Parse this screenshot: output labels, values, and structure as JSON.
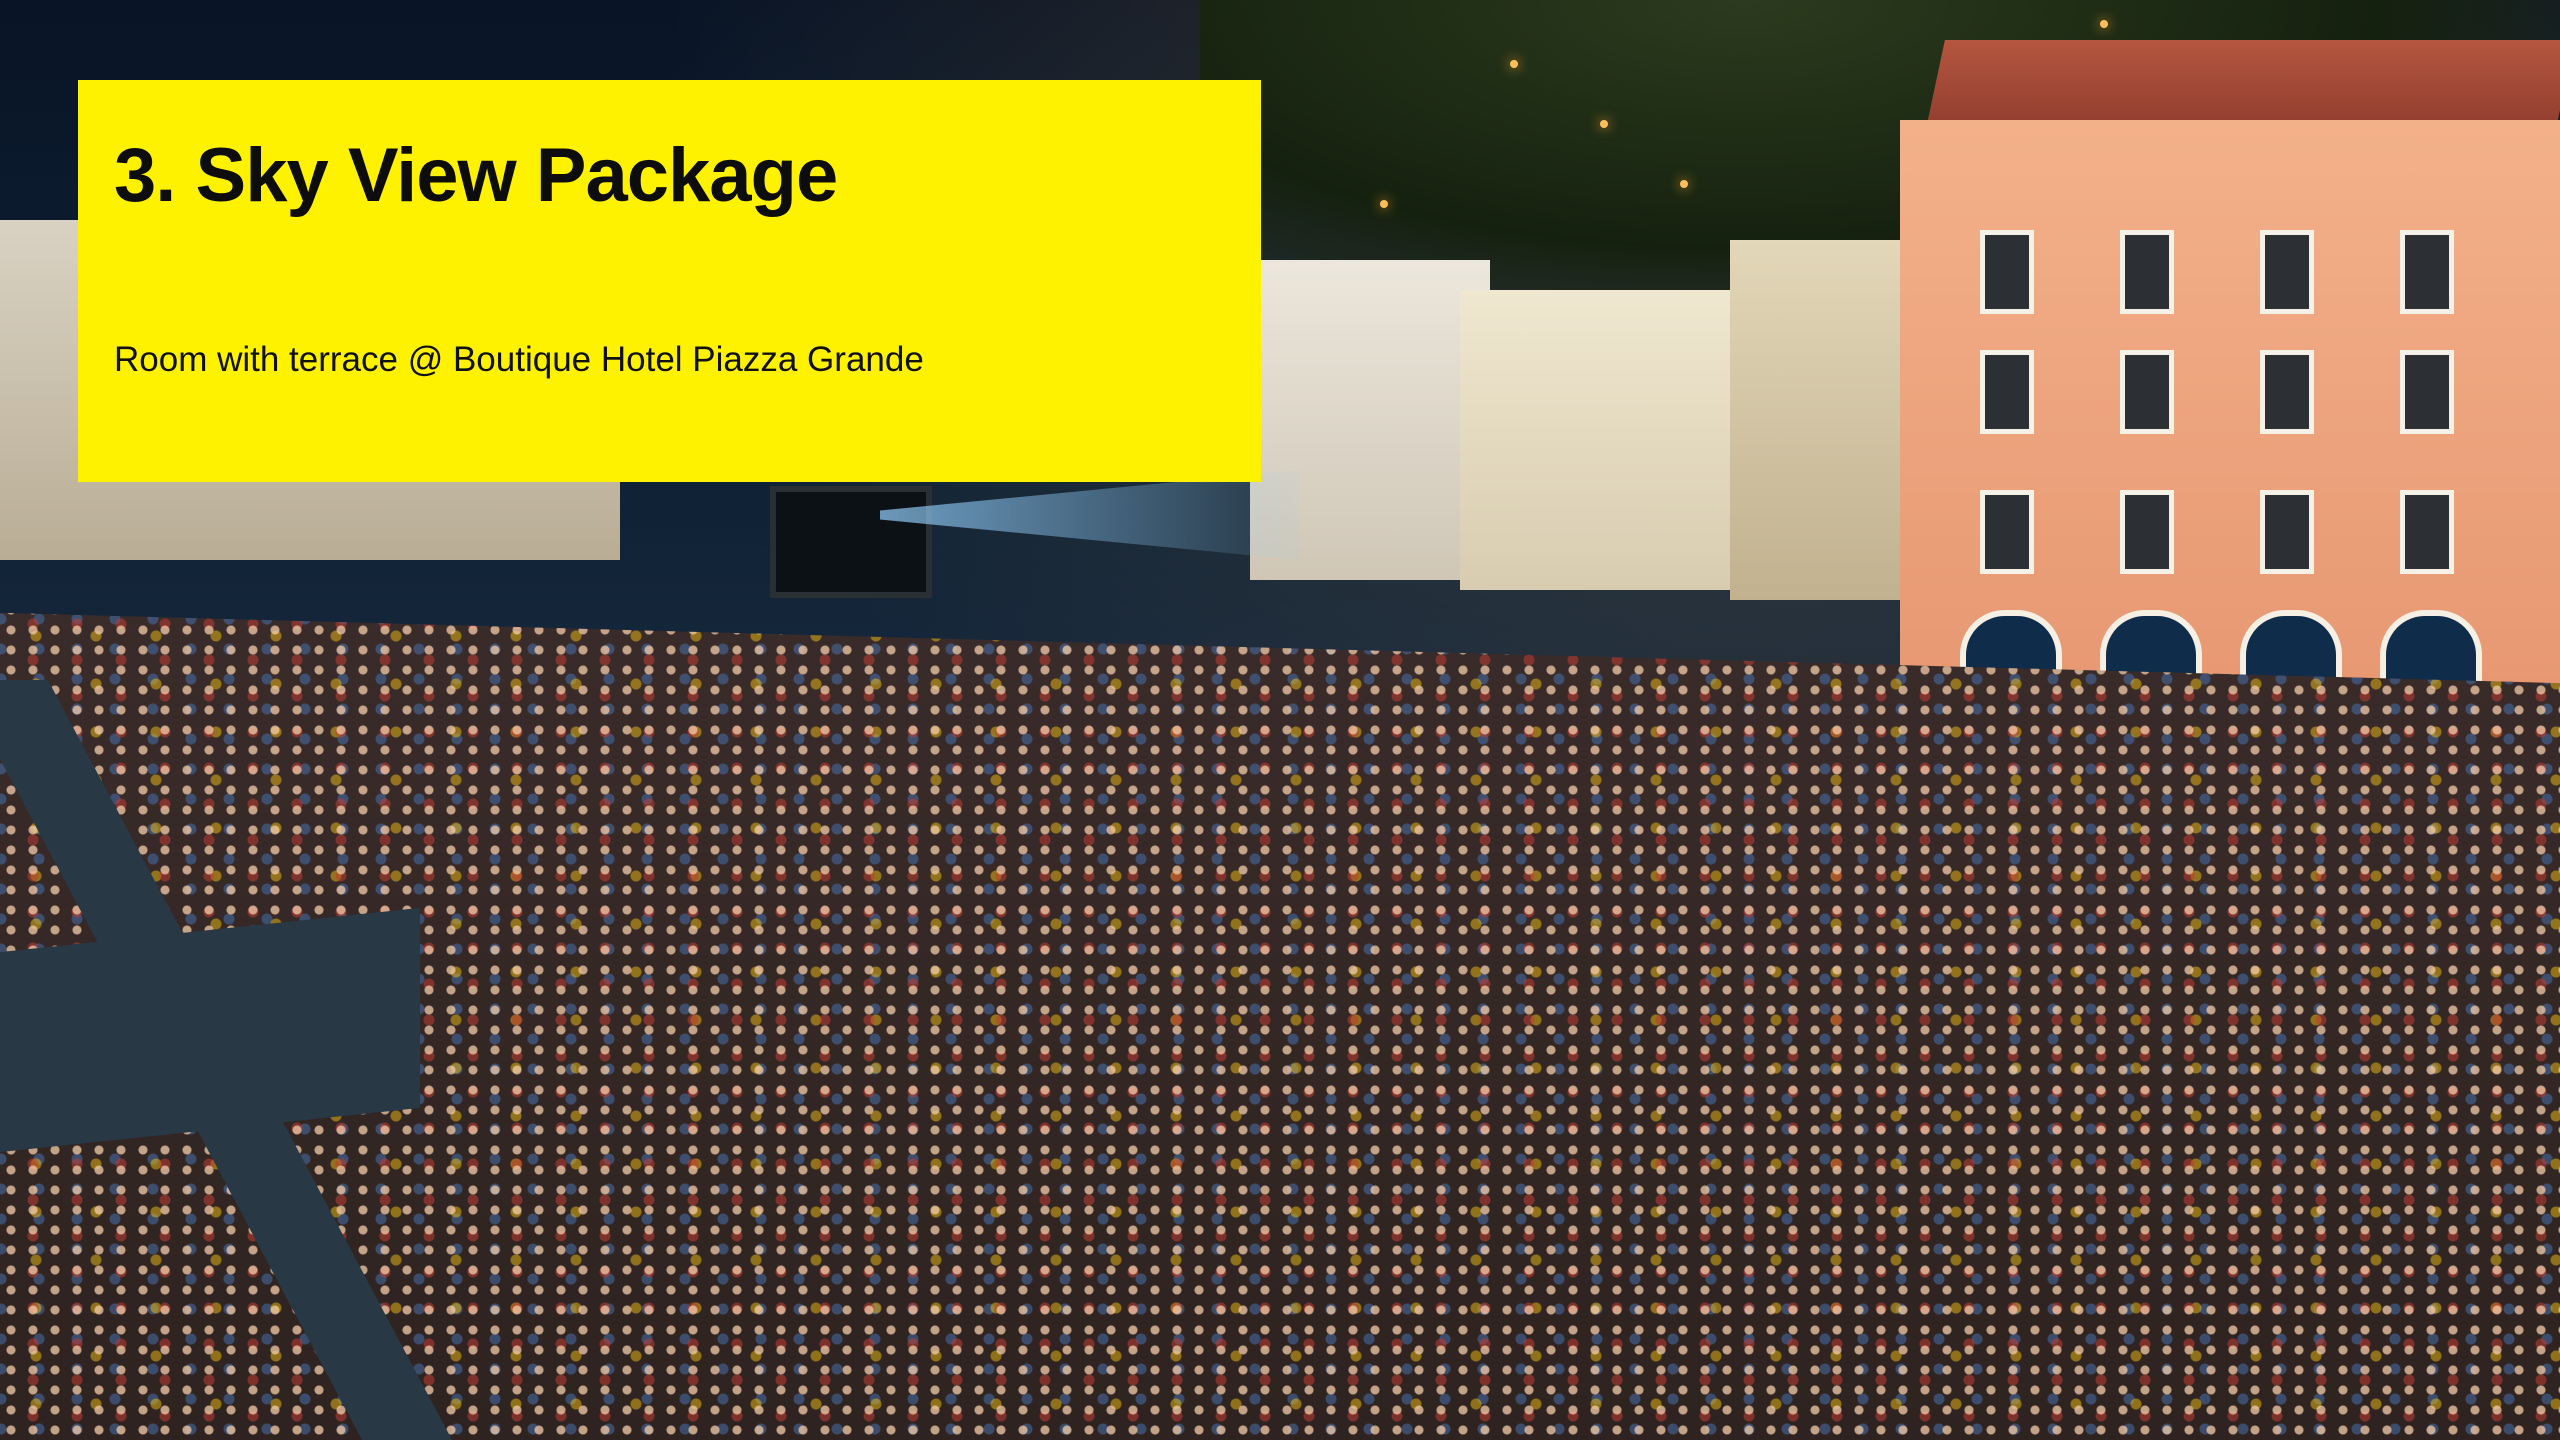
{
  "slide": {
    "title": "3. Sky View Package",
    "subtitle": "Room with terrace @ Boutique Hotel Piazza Grande"
  },
  "colors": {
    "accent": "#FFF200",
    "text": "#0D0D0D"
  },
  "background_image": {
    "subject": "open-air cinema crowd in town square at night"
  }
}
